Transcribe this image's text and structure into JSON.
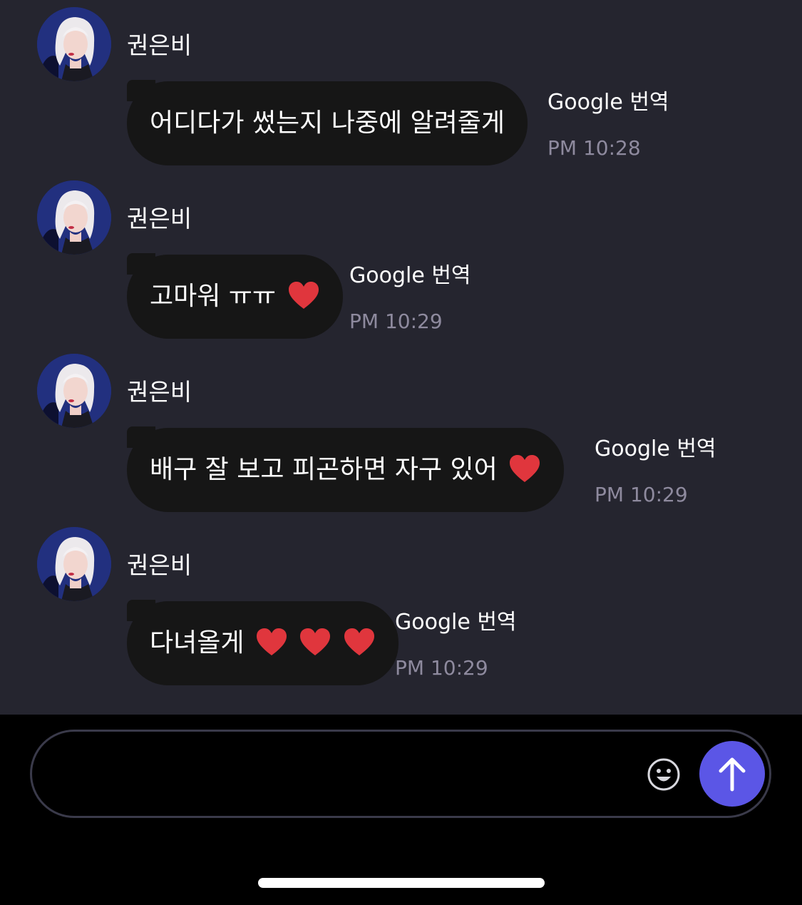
{
  "messages": [
    {
      "sender": "권은비",
      "text": "어디다가 썼는지 나중에 알려줄게",
      "hearts": 0,
      "translate": "Google 번역",
      "time": "PM 10:28"
    },
    {
      "sender": "권은비",
      "text": "고마워 ㅠㅠ",
      "hearts": 1,
      "translate": "Google 번역",
      "time": "PM 10:29"
    },
    {
      "sender": "권은비",
      "text": "배구 잘 보고 피곤하면 자구 있어 ",
      "hearts": 1,
      "translate": "Google 번역",
      "time": "PM 10:29"
    },
    {
      "sender": "권은비",
      "text": "다녀올게 ",
      "hearts": 3,
      "translate": "Google 번역",
      "time": "PM 10:29"
    }
  ],
  "input": {
    "value": "",
    "placeholder": ""
  },
  "icons": {
    "emoji": "smiley-face-icon",
    "send": "arrow-up-icon",
    "heart": "red-heart-icon"
  },
  "colors": {
    "background": "#25252f",
    "bubble": "#161616",
    "send_button": "#5b56e6",
    "heart": "#e0363d",
    "timestamp": "#8e8a9e"
  }
}
